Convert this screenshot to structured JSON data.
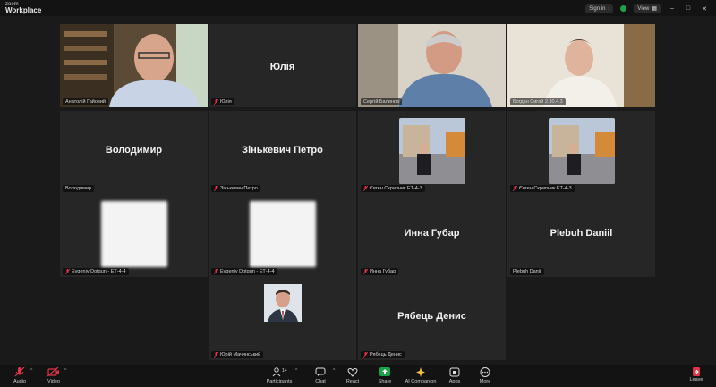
{
  "app": {
    "brand_line1": "zoom",
    "brand_line2": "Workplace"
  },
  "titlebar": {
    "signin_label": "Sign in",
    "view_label": "View"
  },
  "tiles": [
    {
      "id": "t1",
      "label": "Анатолій Гайовий"
    },
    {
      "id": "t2",
      "name": "Юлія",
      "label": "Юлія"
    },
    {
      "id": "t3",
      "label": "Сергій Балинов"
    },
    {
      "id": "t4",
      "label": "Богдан Сигай 2.30.4.3"
    },
    {
      "id": "t5",
      "name": "Володимир",
      "label": "Володимир"
    },
    {
      "id": "t6",
      "name": "Зінькевич Петро",
      "label": "Зінькевич Петро"
    },
    {
      "id": "t7",
      "label": "Євген Скрипник ЕТ-4-3"
    },
    {
      "id": "t8",
      "label": "Євген Скрипник ЕТ-4-3"
    },
    {
      "id": "t9",
      "label": "Evgeniy Dotgun - ЕТ-4-4"
    },
    {
      "id": "t10",
      "label": "Evgeniy Dotgun - ЕТ-4-4"
    },
    {
      "id": "t11",
      "name": "Инна Губар",
      "label": "Инна Губар"
    },
    {
      "id": "t12",
      "name": "Plebuh Daniil",
      "label": "Plebuh Daniil"
    },
    {
      "id": "t13",
      "label": "Юрій Мачинський"
    },
    {
      "id": "t14",
      "name": "Рябець Денис",
      "label": "Рябець Денис"
    }
  ],
  "toolbar": {
    "audio": "Audio",
    "video": "Video",
    "participants": "Participants",
    "participants_count": "14",
    "chat": "Chat",
    "react": "React",
    "share": "Share",
    "ai": "AI Companion",
    "apps": "Apps",
    "more": "More",
    "leave": "Leave"
  },
  "colors": {
    "active_speaker": "#2fbf71",
    "share": "#1aa34a",
    "mute": "#e0344a"
  }
}
